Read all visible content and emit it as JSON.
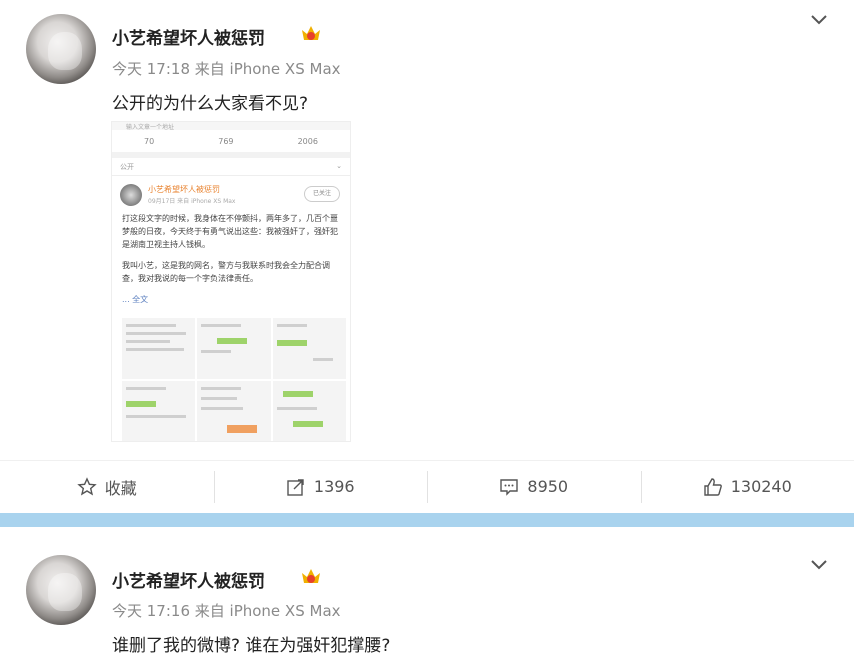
{
  "post1": {
    "username": "小艺希望坏人被惩罚",
    "meta": "今天 17:18 来自 iPhone XS Max",
    "text": "公开的为什么大家看不见?",
    "embedded": {
      "top_hint": "输入文章一个地址",
      "stats": [
        "70",
        "769",
        "2006"
      ],
      "public_label": "公开",
      "name": "小艺希望坏人被惩罚",
      "sub": "09月17日 来自 iPhone XS Max",
      "follow": "已关注",
      "para1": "打这段文字的时候，我身体在不停颤抖，两年多了，几百个噩梦般的日夜，今天终于有勇气说出这些：我被强奸了，强奸犯是湖南卫视主持人钱枫。",
      "para2": "我叫小艺，这是我的网名，警方与我联系时我会全力配合调查，我对我说的每一个字负法律责任。",
      "more": "... 全文"
    },
    "actions": {
      "favorite": "收藏",
      "repost": "1396",
      "comment": "8950",
      "like": "130240"
    }
  },
  "post2": {
    "username": "小艺希望坏人被惩罚",
    "meta": "今天 17:16 来自 iPhone XS Max",
    "text": "谁删了我的微博? 谁在为强奸犯撑腰?"
  },
  "colors": {
    "divider": "#a9d3ee",
    "accent_orange": "#e8822e"
  }
}
